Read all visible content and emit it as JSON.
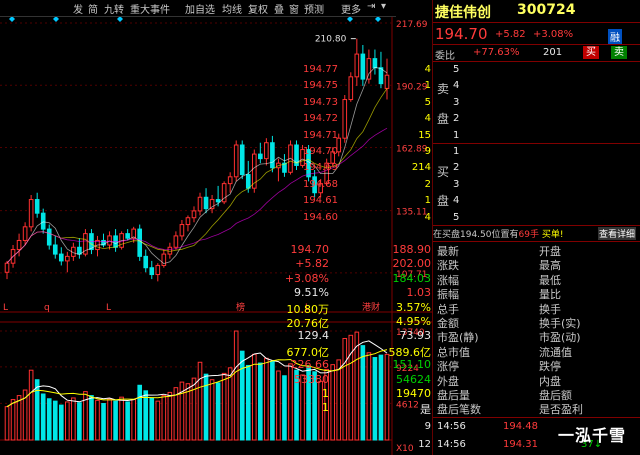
{
  "toolbar": {
    "items": [
      "发",
      "简",
      "九转",
      "重大事件",
      "加自选",
      "均线",
      "复权",
      "叠",
      "窗",
      "预测",
      "更多"
    ]
  },
  "price_axis": {
    "labels": [
      "217.69",
      "190.29",
      "162.89",
      "135.11",
      "107.71"
    ]
  },
  "volume_axis": {
    "labels": [
      "13740",
      "9224",
      "4612"
    ],
    "unit": "X10"
  },
  "markers": {
    "high_label": "210.80",
    "events": [
      {
        "text": "L",
        "color": "#ff4040"
      },
      {
        "text": "q",
        "color": "#ff4040"
      },
      {
        "text": "L",
        "color": "#ff4040"
      },
      {
        "text": "榜",
        "color": "#ff4040"
      },
      {
        "text": "L",
        "color": "#ff4040"
      },
      {
        "text": "港财",
        "color": "#ff4040"
      }
    ]
  },
  "stock": {
    "name": "捷佳伟创",
    "code": "300724",
    "price": "194.70",
    "change": "+5.82",
    "change_pct": "+3.08%",
    "tag": "融"
  },
  "weibi": {
    "label": "委比",
    "ratio": "+77.63%",
    "diff": "201",
    "buy_btn": "买",
    "sell_btn": "卖"
  },
  "sell_side_label": [
    "卖",
    "盘"
  ],
  "buy_side_label": [
    "买",
    "盘"
  ],
  "sell_orders": [
    {
      "level": "5",
      "price": "194.77",
      "vol": "4"
    },
    {
      "level": "4",
      "price": "194.75",
      "vol": "1"
    },
    {
      "level": "3",
      "price": "194.73",
      "vol": "5"
    },
    {
      "level": "2",
      "price": "194.72",
      "vol": "4"
    },
    {
      "level": "1",
      "price": "194.71",
      "vol": "15"
    }
  ],
  "buy_orders": [
    {
      "level": "1",
      "price": "194.70",
      "vol": "9"
    },
    {
      "level": "2",
      "price": "194.69",
      "vol": "214"
    },
    {
      "level": "3",
      "price": "194.68",
      "vol": "2"
    },
    {
      "level": "4",
      "price": "194.61",
      "vol": "1"
    },
    {
      "level": "5",
      "price": "194.60",
      "vol": "4"
    }
  ],
  "notice": {
    "text_a": "在买盘194.50位置有",
    "text_b": "69手",
    "text_c": "买单!",
    "detail_btn": "查看详细"
  },
  "quote": [
    {
      "l": "最新",
      "v": "194.70",
      "c": "red",
      "l2": "开盘",
      "v2": "188.90",
      "c2": "red"
    },
    {
      "l": "涨跌",
      "v": "+5.82",
      "c": "red",
      "l2": "最高",
      "v2": "202.00",
      "c2": "red"
    },
    {
      "l": "涨幅",
      "v": "+3.08%",
      "c": "red",
      "l2": "最低",
      "v2": "184.03",
      "c2": "grn"
    },
    {
      "l": "振幅",
      "v": "9.51%",
      "c": "wht",
      "l2": "量比",
      "v2": "1.03",
      "c2": "red"
    },
    {
      "l": "总手",
      "v": "10.80万",
      "c": "yel",
      "l2": "换手",
      "v2": "3.57%",
      "c2": "yel"
    },
    {
      "l": "金额",
      "v": "20.76亿",
      "c": "yel",
      "l2": "换手(实)",
      "v2": "4.95%",
      "c2": "yel"
    },
    {
      "l": "市盈(静)",
      "v": "129.4",
      "c": "wht",
      "l2": "市盈(动)",
      "v2": "73.93",
      "c2": "wht"
    },
    {
      "l": "总市值",
      "v": "677.0亿",
      "c": "yel",
      "l2": "流通值",
      "v2": "589.6亿",
      "c2": "yel"
    },
    {
      "l": "涨停",
      "v": "226.66",
      "c": "red",
      "l2": "跌停",
      "v2": "151.10",
      "c2": "grn"
    },
    {
      "l": "外盘",
      "v": "53380",
      "c": "red",
      "l2": "内盘",
      "v2": "54624",
      "c2": "grn"
    },
    {
      "l": "盘后量",
      "v": "1",
      "c": "yel",
      "l2": "盘后额",
      "v2": "19470",
      "c2": "yel"
    },
    {
      "l": "盘后笔数",
      "v": "1",
      "c": "yel",
      "l2": "是否盈利",
      "v2": "是",
      "c2": "wht"
    }
  ],
  "ticks": [
    {
      "time": "14:56",
      "price": "194.48",
      "vol": "",
      "dir": "",
      "extra": "9"
    },
    {
      "time": "14:56",
      "price": "194.31",
      "vol": "37",
      "dir": "↓",
      "extra": "12"
    }
  ],
  "watermark": "一泓千雪",
  "chart_data": {
    "type": "candlestick",
    "candles": [
      {
        "o": 108,
        "h": 113,
        "l": 105,
        "c": 112
      },
      {
        "o": 112,
        "h": 120,
        "l": 110,
        "c": 118
      },
      {
        "o": 118,
        "h": 125,
        "l": 115,
        "c": 122
      },
      {
        "o": 122,
        "h": 130,
        "l": 120,
        "c": 128
      },
      {
        "o": 128,
        "h": 142,
        "l": 126,
        "c": 140
      },
      {
        "o": 140,
        "h": 143,
        "l": 132,
        "c": 134
      },
      {
        "o": 134,
        "h": 136,
        "l": 125,
        "c": 127
      },
      {
        "o": 127,
        "h": 129,
        "l": 118,
        "c": 120
      },
      {
        "o": 120,
        "h": 124,
        "l": 114,
        "c": 116
      },
      {
        "o": 116,
        "h": 119,
        "l": 111,
        "c": 113
      },
      {
        "o": 113,
        "h": 117,
        "l": 108,
        "c": 115
      },
      {
        "o": 115,
        "h": 121,
        "l": 113,
        "c": 119
      },
      {
        "o": 119,
        "h": 123,
        "l": 114,
        "c": 116
      },
      {
        "o": 116,
        "h": 127,
        "l": 115,
        "c": 125
      },
      {
        "o": 125,
        "h": 127,
        "l": 116,
        "c": 118
      },
      {
        "o": 118,
        "h": 124,
        "l": 115,
        "c": 122
      },
      {
        "o": 122,
        "h": 125,
        "l": 119,
        "c": 120
      },
      {
        "o": 120,
        "h": 126,
        "l": 118,
        "c": 124
      },
      {
        "o": 124,
        "h": 127,
        "l": 117,
        "c": 119
      },
      {
        "o": 119,
        "h": 126,
        "l": 118,
        "c": 125
      },
      {
        "o": 125,
        "h": 127,
        "l": 122,
        "c": 123
      },
      {
        "o": 123,
        "h": 128,
        "l": 121,
        "c": 127
      },
      {
        "o": 127,
        "h": 129,
        "l": 113,
        "c": 115
      },
      {
        "o": 115,
        "h": 118,
        "l": 108,
        "c": 110
      },
      {
        "o": 110,
        "h": 113,
        "l": 105,
        "c": 107
      },
      {
        "o": 107,
        "h": 112,
        "l": 104,
        "c": 111
      },
      {
        "o": 111,
        "h": 118,
        "l": 110,
        "c": 116
      },
      {
        "o": 116,
        "h": 121,
        "l": 114,
        "c": 119
      },
      {
        "o": 119,
        "h": 126,
        "l": 118,
        "c": 124
      },
      {
        "o": 124,
        "h": 131,
        "l": 122,
        "c": 129
      },
      {
        "o": 129,
        "h": 133,
        "l": 126,
        "c": 132
      },
      {
        "o": 132,
        "h": 137,
        "l": 130,
        "c": 135
      },
      {
        "o": 135,
        "h": 143,
        "l": 133,
        "c": 141
      },
      {
        "o": 141,
        "h": 145,
        "l": 134,
        "c": 136
      },
      {
        "o": 136,
        "h": 142,
        "l": 134,
        "c": 140
      },
      {
        "o": 140,
        "h": 146,
        "l": 137,
        "c": 139
      },
      {
        "o": 139,
        "h": 148,
        "l": 138,
        "c": 147
      },
      {
        "o": 147,
        "h": 152,
        "l": 143,
        "c": 150
      },
      {
        "o": 150,
        "h": 166,
        "l": 148,
        "c": 164
      },
      {
        "o": 164,
        "h": 166,
        "l": 149,
        "c": 151
      },
      {
        "o": 151,
        "h": 157,
        "l": 143,
        "c": 145
      },
      {
        "o": 145,
        "h": 162,
        "l": 143,
        "c": 160
      },
      {
        "o": 160,
        "h": 165,
        "l": 156,
        "c": 158
      },
      {
        "o": 158,
        "h": 167,
        "l": 155,
        "c": 165
      },
      {
        "o": 165,
        "h": 168,
        "l": 152,
        "c": 154
      },
      {
        "o": 154,
        "h": 158,
        "l": 148,
        "c": 156
      },
      {
        "o": 156,
        "h": 160,
        "l": 150,
        "c": 152
      },
      {
        "o": 152,
        "h": 166,
        "l": 151,
        "c": 164
      },
      {
        "o": 164,
        "h": 166,
        "l": 153,
        "c": 155
      },
      {
        "o": 155,
        "h": 164,
        "l": 154,
        "c": 162
      },
      {
        "o": 162,
        "h": 164,
        "l": 148,
        "c": 150
      },
      {
        "o": 150,
        "h": 153,
        "l": 141,
        "c": 143
      },
      {
        "o": 143,
        "h": 149,
        "l": 141,
        "c": 147
      },
      {
        "o": 147,
        "h": 158,
        "l": 146,
        "c": 156
      },
      {
        "o": 156,
        "h": 163,
        "l": 155,
        "c": 161
      },
      {
        "o": 161,
        "h": 169,
        "l": 159,
        "c": 167
      },
      {
        "o": 167,
        "h": 186,
        "l": 165,
        "c": 184
      },
      {
        "o": 184,
        "h": 196,
        "l": 183,
        "c": 194
      },
      {
        "o": 194,
        "h": 210.8,
        "l": 190,
        "c": 204
      },
      {
        "o": 204,
        "h": 208,
        "l": 190,
        "c": 193
      },
      {
        "o": 193,
        "h": 206,
        "l": 191,
        "c": 202
      },
      {
        "o": 202,
        "h": 206,
        "l": 195,
        "c": 198
      },
      {
        "o": 198,
        "h": 205,
        "l": 189,
        "c": 191
      },
      {
        "o": 188.9,
        "h": 202,
        "l": 184.03,
        "c": 194.7
      }
    ],
    "volumes": [
      4200,
      5100,
      5600,
      6300,
      8800,
      7600,
      5800,
      5200,
      4900,
      4400,
      4800,
      5300,
      4700,
      6100,
      5600,
      5000,
      4600,
      5200,
      4900,
      5400,
      4800,
      5100,
      6900,
      6200,
      5300,
      4900,
      5600,
      6000,
      6600,
      7300,
      7100,
      7800,
      9800,
      8300,
      7600,
      7200,
      8400,
      9100,
      13740,
      11200,
      9400,
      10800,
      9700,
      10300,
      9900,
      8700,
      8100,
      9600,
      8800,
      8200,
      9300,
      8600,
      7400,
      8900,
      9500,
      10100,
      12800,
      13200,
      13600,
      11900,
      11000,
      10400,
      10700,
      10800
    ]
  }
}
